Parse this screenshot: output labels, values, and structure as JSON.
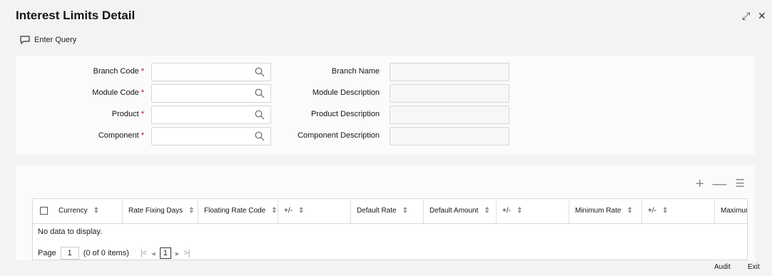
{
  "window": {
    "title": "Interest Limits Detail",
    "controls": {
      "expand": "⤢",
      "close": "✕"
    }
  },
  "toolbar": {
    "enter_query": "Enter Query"
  },
  "form": {
    "branch_code_label": "Branch Code",
    "module_code_label": "Module Code",
    "product_label": "Product",
    "component_label": "Component",
    "branch_name_label": "Branch Name",
    "module_description_label": "Module Description",
    "product_description_label": "Product Description",
    "component_description_label": "Component Description",
    "required_mark": "*",
    "branch_code_value": "",
    "module_code_value": "",
    "product_value": "",
    "component_value": ""
  },
  "grid": {
    "actions": {
      "add": "+",
      "remove": "—",
      "columns": "☰"
    },
    "columns": [
      "Currency",
      "Rate Fixing Days",
      "Floating Rate Code",
      "+/-",
      "Default Rate",
      "Default Amount",
      "+/-",
      "Minimum Rate",
      "+/-",
      "Maximum"
    ],
    "sort_glyph": "⇕",
    "empty_message": "No data to display.",
    "pager": {
      "page_label": "Page",
      "page_value": "1",
      "items_text": "(0 of 0 items)",
      "first": "|<",
      "prev": "◂",
      "current": "1",
      "next": "▸",
      "last": ">|"
    }
  },
  "footer": {
    "audit": "Audit",
    "exit": "Exit"
  }
}
